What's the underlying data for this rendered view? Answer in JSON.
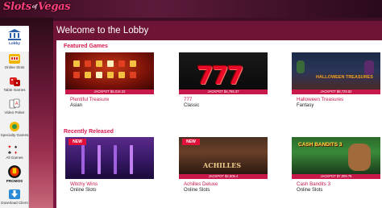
{
  "header": {
    "logo": "Slots of Vegas",
    "logo_part1": "Slots",
    "logo_part2": "of",
    "logo_part3": "Vegas"
  },
  "sidebar": {
    "items": [
      {
        "label": "Lobby",
        "icon": "bank-icon",
        "active": true
      },
      {
        "label": "Online Slots",
        "icon": "slot-machine-icon"
      },
      {
        "label": "Table Games",
        "icon": "dice-icon"
      },
      {
        "label": "Video Poker",
        "icon": "cards-icon"
      },
      {
        "label": "Specialty Games",
        "icon": "specialty-icon"
      },
      {
        "label": "All Games",
        "icon": "card-suits-icon"
      },
      {
        "label": "PROMOS",
        "icon": "promos-icon"
      },
      {
        "label": "Download Client",
        "icon": "download-icon"
      }
    ]
  },
  "main": {
    "title": "Welcome to the Lobby",
    "featured": {
      "title": "Featured Games",
      "games": [
        {
          "name": "Plentiful Treasure",
          "category": "Asian",
          "jackpot": "JACKPOT $5,016.32"
        },
        {
          "name": "777",
          "category": "Classic",
          "jackpot": "JACKPOT $4,755.37"
        },
        {
          "name": "Halloween Treasures",
          "category": "Fantasy",
          "jackpot": "JACKPOT $8,729.82",
          "thumb_title": "HALLOWEEN TREASURES"
        }
      ]
    },
    "recent": {
      "title": "Recently Released",
      "games": [
        {
          "name": "Witchy Wins",
          "category": "Online Slots",
          "badge": "NEW"
        },
        {
          "name": "Achilles Deluxe",
          "category": "Online Slots",
          "badge": "NEW",
          "jackpot": "JACKPOT $2,505.4",
          "thumb_title": "ACHILLES"
        },
        {
          "name": "Cash Bandits 3",
          "category": "Online Slots",
          "jackpot": "JACKPOT $7,009.75",
          "thumb_title": "CASH BANDITS 3"
        }
      ]
    }
  },
  "colors": {
    "accent": "#c8184a",
    "background": "#6e1436",
    "sidebar": "#f2f2f2"
  }
}
